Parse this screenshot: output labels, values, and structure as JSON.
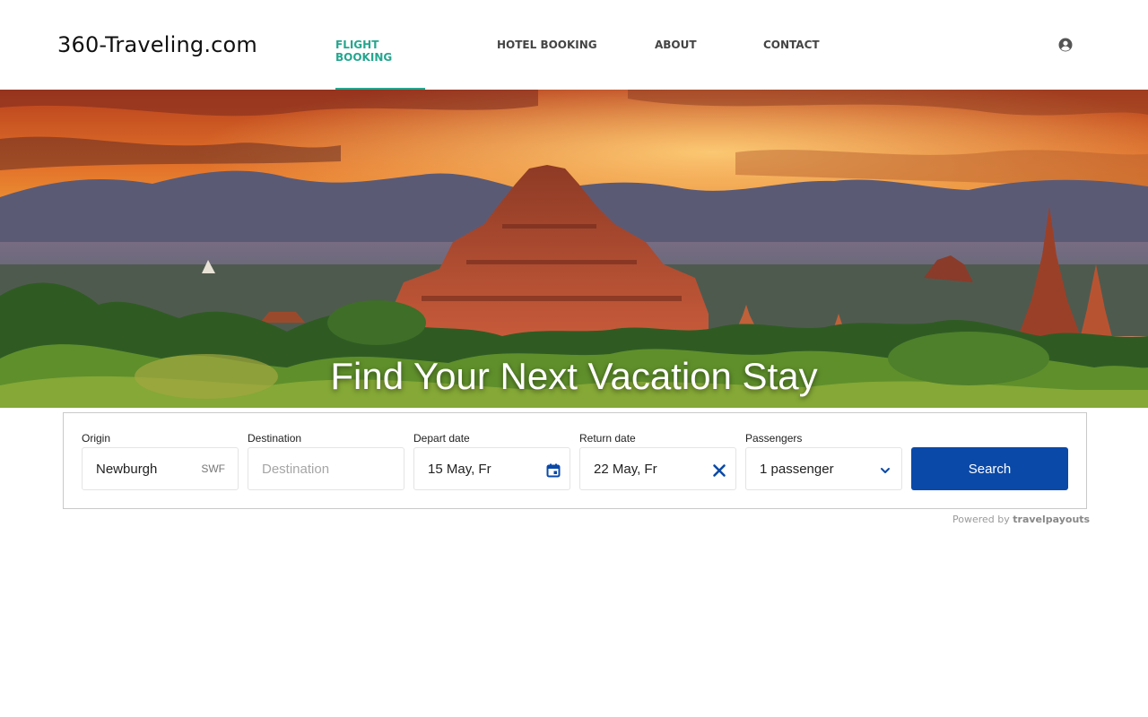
{
  "header": {
    "logo": "360-Traveling.com",
    "nav": [
      {
        "label": "FLIGHT BOOKING",
        "active": true
      },
      {
        "label": "HOTEL BOOKING",
        "active": false
      },
      {
        "label": "ABOUT",
        "active": false
      },
      {
        "label": "CONTACT",
        "active": false
      }
    ],
    "account_icon": "user-circle-icon"
  },
  "hero": {
    "title": "Find Your Next Vacation Stay",
    "image": "temple-sunset-landscape"
  },
  "search": {
    "origin": {
      "label": "Origin",
      "value": "Newburgh",
      "iata": "SWF"
    },
    "destination": {
      "label": "Destination",
      "placeholder": "Destination"
    },
    "depart": {
      "label": "Depart date",
      "value": "15 May, Fr",
      "icon": "calendar-icon"
    },
    "return": {
      "label": "Return date",
      "value": "22 May, Fr",
      "icon": "close-icon"
    },
    "passengers": {
      "label": "Passengers",
      "value": "1 passenger",
      "icon": "chevron-down-icon"
    },
    "submit_label": "Search"
  },
  "footer": {
    "powered_prefix": "Powered by",
    "powered_brand": "travelpayouts"
  },
  "colors": {
    "accent": "#26a68f",
    "button": "#0a49a8"
  }
}
